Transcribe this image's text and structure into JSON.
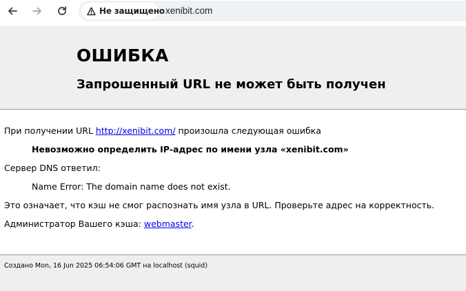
{
  "browser": {
    "security_label": "Не защищено",
    "url": "xenibit.com"
  },
  "header": {
    "title": "ОШИБКА",
    "subtitle": "Запрошенный URL не может быть получен"
  },
  "content": {
    "line1_prefix": "При получении URL ",
    "line1_link": "http://xenibit.com/",
    "line1_suffix": " произошла следующая ошибка",
    "error_message": "Невозможно определить IP-адрес по имени узла «xenibit.com»",
    "dns_label": "Сервер DNS ответил:",
    "dns_response": "Name Error: The domain name does not exist.",
    "explanation": "Это означает, что кэш не смог распознать имя узла в URL. Проверьте адрес на корректность.",
    "admin_prefix": "Администратор Вашего кэша: ",
    "admin_link": "webmaster",
    "admin_suffix": "."
  },
  "footer": {
    "generated": "Создано Mon, 16 Jun 2025 06:54:06 GMT на localhost (squid)"
  }
}
